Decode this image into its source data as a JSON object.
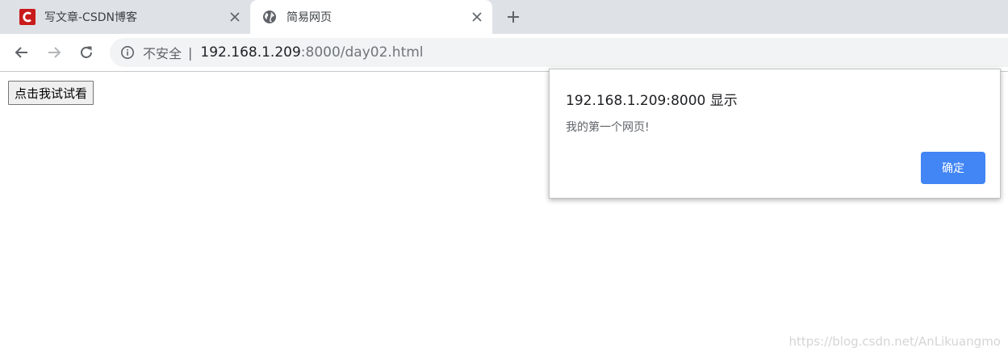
{
  "browser": {
    "tabs": [
      {
        "title": "写文章-CSDN博客",
        "icon": "csdn-logo-icon",
        "active": false
      },
      {
        "title": "简易网页",
        "icon": "globe-icon",
        "active": true
      }
    ],
    "address_bar": {
      "security_label": "不安全",
      "separator": "|",
      "url_host": "192.168.1.209",
      "url_rest": ":8000/day02.html"
    }
  },
  "page": {
    "button_label": "点击我试试看"
  },
  "dialog": {
    "origin": "192.168.1.209:8000 显示",
    "message": "我的第一个网页!",
    "ok_label": "确定",
    "accent_color": "#4285f4"
  },
  "watermark": "https://blog.csdn.net/AnLikuangmo",
  "colors": {
    "tabstrip": "#dee1e6",
    "omnibox": "#f1f3f4",
    "csdn_red": "#c91b1b"
  }
}
